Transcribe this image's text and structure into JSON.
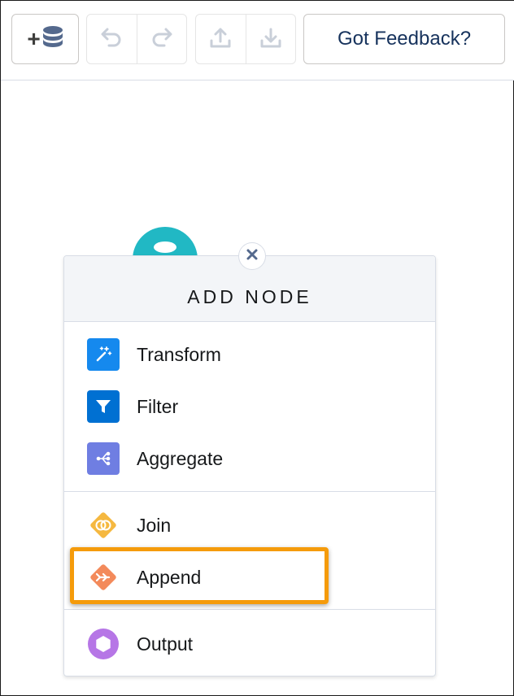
{
  "toolbar": {
    "add_dataset_label": "+",
    "feedback_label": "Got Feedback?"
  },
  "panel": {
    "title": "ADD NODE",
    "groups": [
      [
        {
          "label": "Transform",
          "icon": "magic-wand-icon",
          "color": "#1589ee"
        },
        {
          "label": "Filter",
          "icon": "filter-icon",
          "color": "#0070d2"
        },
        {
          "label": "Aggregate",
          "icon": "aggregate-icon",
          "color": "#6f7ee2"
        }
      ],
      [
        {
          "label": "Join",
          "icon": "join-icon",
          "color": "#f5b840"
        },
        {
          "label": "Append",
          "icon": "append-icon",
          "color": "#f38a5b"
        }
      ],
      [
        {
          "label": "Output",
          "icon": "output-icon",
          "color": "#b676e6"
        }
      ]
    ]
  },
  "colors": {
    "accent_dark": "#16325c",
    "canvas_node": "#21b8c4",
    "highlight": "#f59b0b"
  }
}
